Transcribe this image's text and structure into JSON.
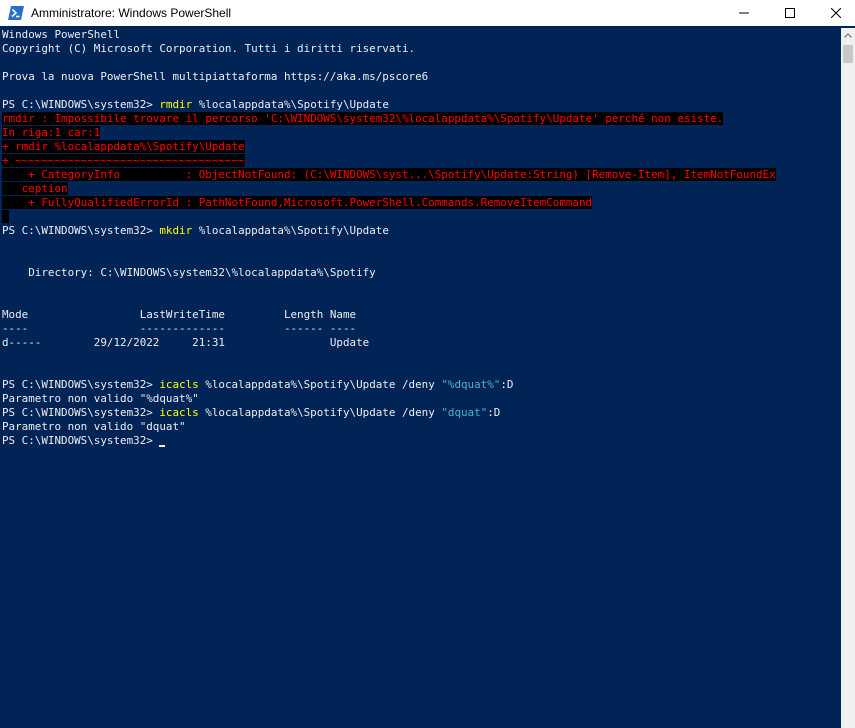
{
  "window": {
    "title": "Amministratore: Windows PowerShell",
    "icon": "powershell-icon",
    "controls": [
      "minimize-icon",
      "maximize-icon",
      "close-icon"
    ]
  },
  "colors": {
    "background": "#012456",
    "text": "#eeedf0",
    "error_text": "#ff0000",
    "error_background": "#000000",
    "command": "#ffff00",
    "string": "#4fb0c6"
  },
  "console": {
    "banner": {
      "l1": "Windows PowerShell",
      "l2": "Copyright (C) Microsoft Corporation. Tutti i diritti riservati.",
      "l3": "Prova la nuova PowerShell multipiattaforma https://aka.ms/pscore6"
    },
    "prompt": "PS C:\\WINDOWS\\system32> ",
    "cmd1": {
      "name": "rmdir",
      "args": " %localappdata%\\Spotify\\Update"
    },
    "error": {
      "l1": "rmdir : Impossibile trovare il percorso 'C:\\WINDOWS\\system32\\%localappdata%\\Spotify\\Update' perché non esiste.",
      "l2": "In riga:1 car:1",
      "l3": "+ rmdir %localappdata%\\Spotify\\Update",
      "l4": "+ ~~~~~~~~~~~~~~~~~~~~~~~~~~~~~~~~~~~",
      "l5": "    + CategoryInfo          : ObjectNotFound: (C:\\WINDOWS\\syst...\\Spotify\\Update:String) [Remove-Item], ItemNotFoundEx",
      "l6": "   ception",
      "l7": "    + FullyQualifiedErrorId : PathNotFound,Microsoft.PowerShell.Commands.RemoveItemCommand",
      "l8": " "
    },
    "cmd2": {
      "name": "mkdir",
      "args": " %localappdata%\\Spotify\\Update"
    },
    "directory_line": "    Directory: C:\\WINDOWS\\system32\\%localappdata%\\Spotify",
    "table": {
      "header": "Mode                 LastWriteTime         Length Name",
      "underline": "----                 -------------         ------ ----",
      "row": "d-----        29/12/2022     21:31                Update"
    },
    "cmd3": {
      "name": "icacls",
      "args": " %localappdata%\\Spotify\\Update /deny ",
      "string": "\"%dquat%\"",
      "suffix": ":D"
    },
    "out3": "Parametro non valido \"%dquat%\"",
    "cmd4": {
      "name": "icacls",
      "args": " %localappdata%\\Spotify\\Update /deny ",
      "string": "\"dquat\"",
      "suffix": ":D"
    },
    "out4": "Parametro non valido \"dquat\""
  }
}
